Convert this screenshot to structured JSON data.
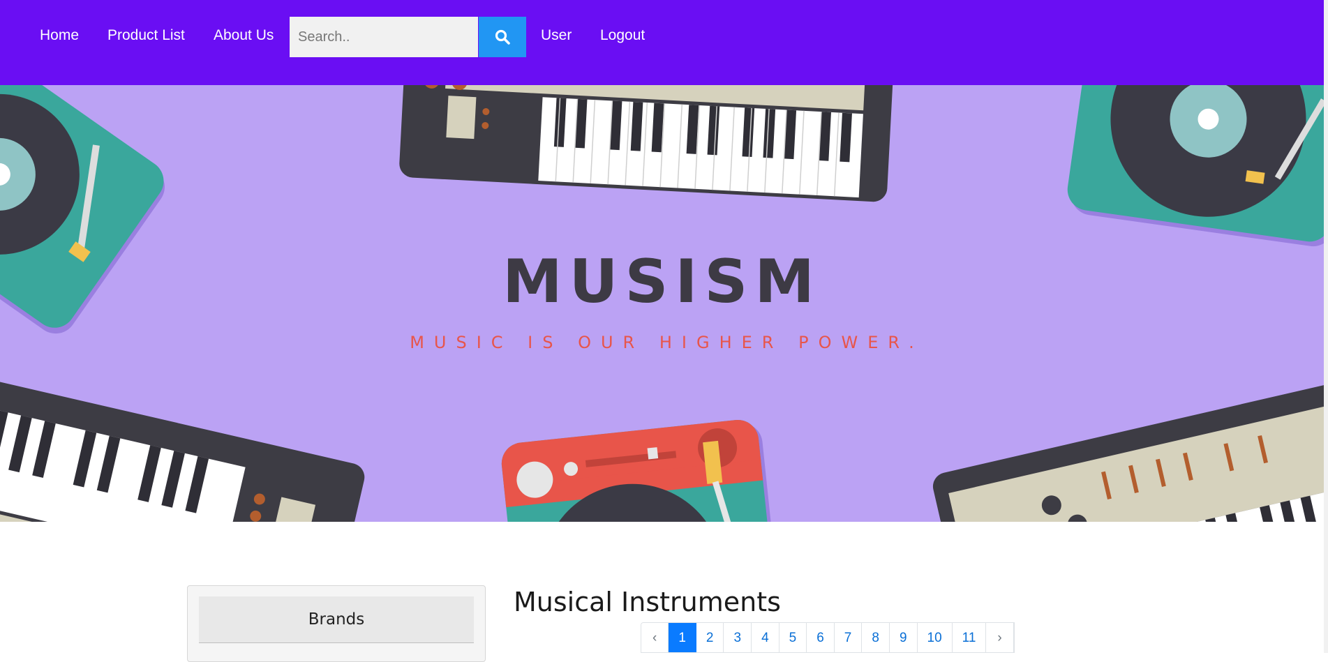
{
  "nav": {
    "links": [
      "Home",
      "Product List",
      "About Us"
    ],
    "search_placeholder": "Search..",
    "search_value": "",
    "right_links": [
      "User",
      "Logout"
    ],
    "search_icon": "search-icon",
    "background": "#6a0ef3",
    "search_button_color": "#2196f3"
  },
  "hero": {
    "title": "MUSISM",
    "tagline": "MUSIC IS OUR HIGHER POWER.",
    "background": "#bba2f4",
    "tagline_color": "#e8554a",
    "decorations": [
      "turntable-icon",
      "keyboard-icon"
    ]
  },
  "sidebar": {
    "title": "Brands"
  },
  "main": {
    "title": "Musical Instruments"
  },
  "pagination": {
    "prev": "‹",
    "next": "›",
    "pages": [
      "1",
      "2",
      "3",
      "4",
      "5",
      "6",
      "7",
      "8",
      "9",
      "10",
      "11"
    ],
    "active_page": "1",
    "active_color": "#0a7bff"
  }
}
